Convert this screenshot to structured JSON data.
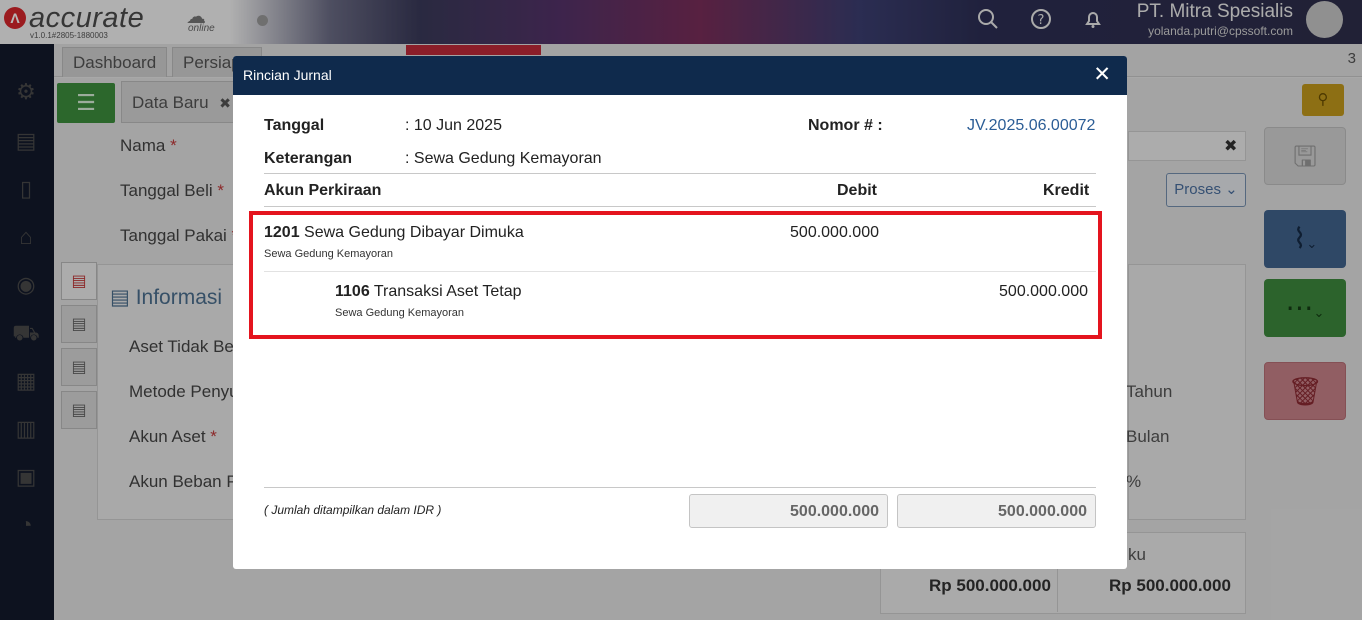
{
  "header": {
    "logo_text": "accurate",
    "logo_sub": "online",
    "version": "v1.0.1#2805-1880003",
    "company_name": "PT. Mitra Spesialis",
    "user_email": "yolanda.putri@cpssoft.com"
  },
  "tabs": {
    "items": [
      "Dashboard",
      "Persiap"
    ],
    "count": "3"
  },
  "form": {
    "tab_label": "Data Baru",
    "tab_close": "✖",
    "nama_label": "Nama",
    "tanggal_beli_label": "Tanggal Beli",
    "tanggal_pakai_label": "Tanggal Pakai",
    "info_title": "Informasi",
    "aset_tidak_label": "Aset Tidak Ber",
    "metode_label": "Metode Penyu",
    "akun_aset_label": "Akun Aset",
    "akun_beban_label": "Akun Beban Pe",
    "required_mark": "*",
    "proses_label": "Proses",
    "tahun_text": "Tahun",
    "bulan_text": "Bulan",
    "percent_text": "%",
    "summary_label": "ku",
    "summary_value_1": "Rp 500.000.000",
    "summary_value_2": "Rp 500.000.000",
    "input_clear": "✖"
  },
  "modal": {
    "title": "Rincian Jurnal",
    "close_label": "✕",
    "tanggal_label": "Tanggal",
    "tanggal_value": ": 10 Jun 2025",
    "keterangan_label": "Keterangan",
    "keterangan_value": ": Sewa Gedung Kemayoran",
    "nomor_label": "Nomor # :",
    "nomor_value": "JV.2025.06.00072",
    "col_akun": "Akun Perkiraan",
    "col_debit": "Debit",
    "col_kredit": "Kredit",
    "rows": [
      {
        "code": "1201",
        "name": "Sewa Gedung Dibayar Dimuka",
        "desc": "Sewa Gedung Kemayoran",
        "debit": "500.000.000",
        "kredit": ""
      },
      {
        "code": "1106",
        "name": "Transaksi Aset Tetap",
        "desc": "Sewa Gedung Kemayoran",
        "debit": "",
        "kredit": "500.000.000"
      }
    ],
    "footer_note": "( Jumlah ditampilkan dalam IDR )",
    "total_debit": "500.000.000",
    "total_kredit": "500.000.000"
  },
  "colors": {
    "modal_header": "#0f2a4c",
    "highlight_border": "#e4141e",
    "nomor_link": "#2b5d96",
    "sidebar": "#121a2c"
  },
  "icons": {
    "sidebar": [
      "gear-icon",
      "building-icon",
      "book-icon",
      "bank-icon",
      "money-bag-icon",
      "cart-icon",
      "cart-box-icon",
      "factory-icon",
      "tax-icon",
      "chart-icon"
    ]
  }
}
